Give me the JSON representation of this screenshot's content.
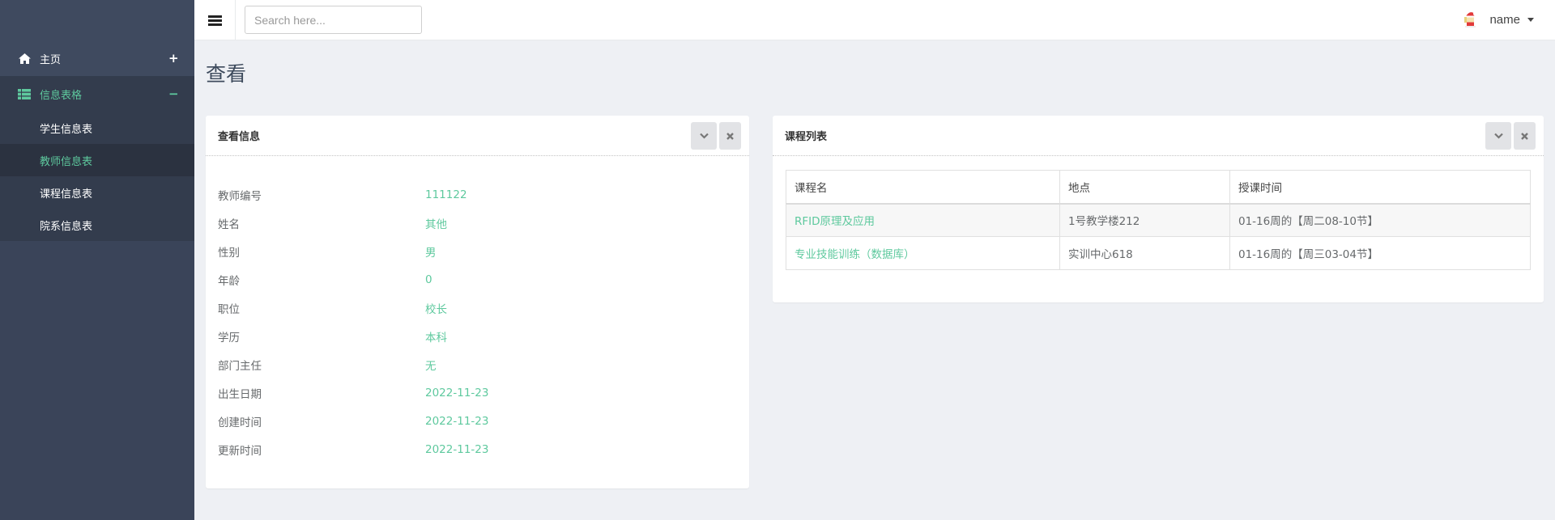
{
  "sidebar": {
    "items": [
      {
        "label": "主页",
        "icon": "home-icon",
        "toggle": "+"
      },
      {
        "label": "信息表格",
        "icon": "table-list-icon",
        "toggle": "−",
        "children": [
          {
            "label": "学生信息表"
          },
          {
            "label": "教师信息表"
          },
          {
            "label": "课程信息表"
          },
          {
            "label": "院系信息表"
          }
        ]
      }
    ],
    "accent": "#5ec99e"
  },
  "topbar": {
    "search_placeholder": "Search here...",
    "user_name": "name"
  },
  "page": {
    "title": "查看"
  },
  "info_panel": {
    "title": "查看信息",
    "rows": [
      {
        "label": "教师编号",
        "value": "111122"
      },
      {
        "label": "姓名",
        "value": "其他"
      },
      {
        "label": "性别",
        "value": "男"
      },
      {
        "label": "年龄",
        "value": "0"
      },
      {
        "label": "职位",
        "value": "校长"
      },
      {
        "label": "学历",
        "value": "本科"
      },
      {
        "label": "部门主任",
        "value": "无"
      },
      {
        "label": "出生日期",
        "value": "2022-11-23"
      },
      {
        "label": "创建时间",
        "value": "2022-11-23"
      },
      {
        "label": "更新时间",
        "value": "2022-11-23"
      }
    ]
  },
  "course_panel": {
    "title": "课程列表",
    "columns": [
      "课程名",
      "地点",
      "授课时间"
    ],
    "rows": [
      {
        "name": "RFID原理及应用",
        "location": "1号教学楼212",
        "time": "01-16周的【周二08-10节】"
      },
      {
        "name": "专业技能训练（数据库）",
        "location": "实训中心618",
        "time": "01-16周的【周三03-04节】"
      }
    ]
  }
}
